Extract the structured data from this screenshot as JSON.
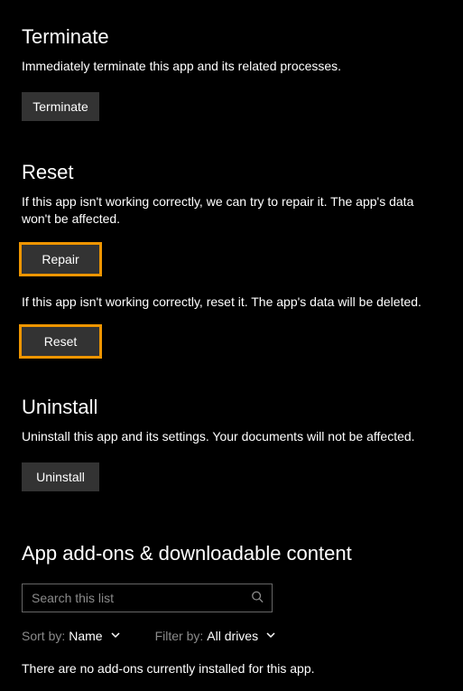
{
  "terminate": {
    "title": "Terminate",
    "description": "Immediately terminate this app and its related processes.",
    "button_label": "Terminate"
  },
  "reset": {
    "title": "Reset",
    "repair_description": "If this app isn't working correctly, we can try to repair it. The app's data won't be affected.",
    "repair_button_label": "Repair",
    "reset_description": "If this app isn't working correctly, reset it. The app's data will be deleted.",
    "reset_button_label": "Reset"
  },
  "uninstall": {
    "title": "Uninstall",
    "description": "Uninstall this app and its settings. Your documents will not be affected.",
    "button_label": "Uninstall"
  },
  "addons": {
    "title": "App add-ons & downloadable content",
    "search_placeholder": "Search this list",
    "sort_by_label": "Sort by:",
    "sort_by_value": "Name",
    "filter_by_label": "Filter by:",
    "filter_by_value": "All drives",
    "no_addons_text": "There are no add-ons currently installed for this app."
  }
}
